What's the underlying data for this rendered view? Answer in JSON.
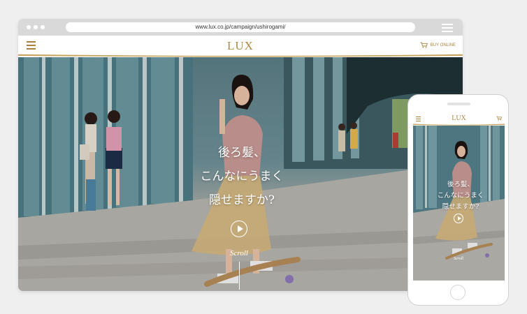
{
  "browser": {
    "url": "www.lux.co.jp/campaign/ushirogami/"
  },
  "site": {
    "logo": "LUX",
    "buy_online": "BUY ONLINE",
    "headline": [
      "後ろ髪、",
      "こんなにうまく",
      "隠せますか?"
    ],
    "scroll_label": "Scroll"
  },
  "mobile": {
    "logo": "LUX",
    "headline": [
      "後ろ髪、",
      "こんなにうまく",
      "隠せますか?"
    ],
    "scroll_label": "Scroll"
  },
  "colors": {
    "brand_gold": "#b08a45",
    "chrome_gray": "#d9d9d9",
    "background": "#efefef"
  },
  "icons": [
    "browser-dot-icon",
    "browser-menu-icon",
    "hamburger-menu-icon",
    "cart-icon",
    "play-icon",
    "scroll-arrow-icon"
  ]
}
